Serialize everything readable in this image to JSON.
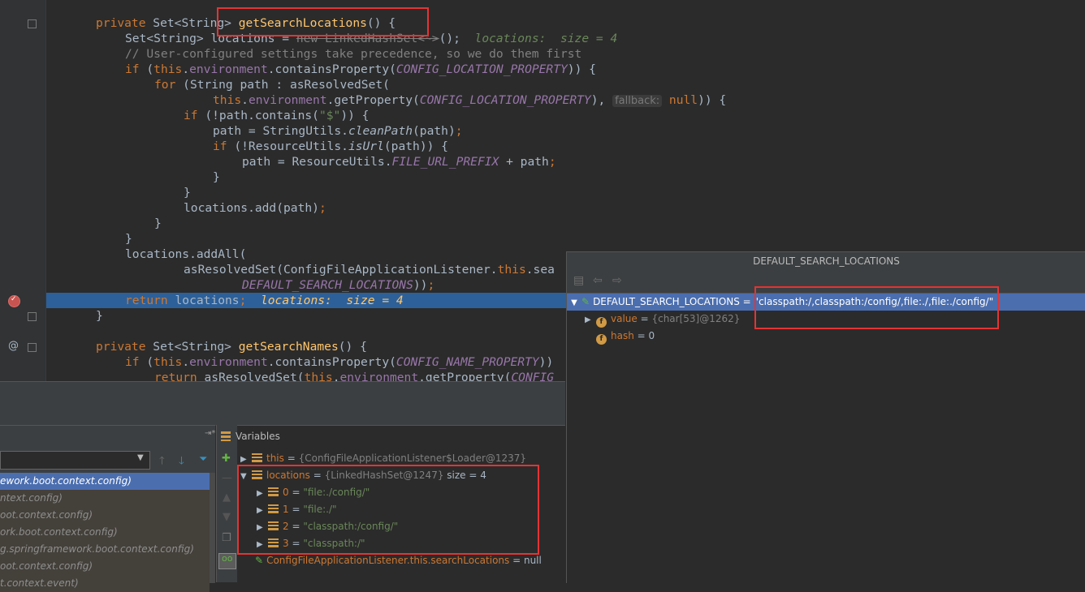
{
  "editor": {
    "lines": [
      {
        "indent": 0,
        "tokens": [
          {
            "t": "private ",
            "c": "kw"
          },
          {
            "t": "Set<String> ",
            "c": ""
          },
          {
            "t": "getSearchLocations",
            "c": "fn"
          },
          {
            "t": "() {",
            "c": ""
          }
        ]
      },
      {
        "indent": 1,
        "tokens": [
          {
            "t": "Set<String> ",
            "c": ""
          },
          {
            "t": "locations = ",
            "c": ""
          },
          {
            "t": "new LinkedHashSet<~>",
            "c": "strike"
          },
          {
            "t": "();",
            "c": ""
          },
          {
            "t": "  locations:  size = 4",
            "c": "inl"
          }
        ]
      },
      {
        "indent": 1,
        "tokens": [
          {
            "t": "// User-configured settings take precedence, so we do them first",
            "c": "cm"
          }
        ]
      },
      {
        "indent": 1,
        "tokens": [
          {
            "t": "if ",
            "c": "kw"
          },
          {
            "t": "(",
            "c": ""
          },
          {
            "t": "this",
            "c": "kw"
          },
          {
            "t": ".",
            "c": ""
          },
          {
            "t": "environment",
            "c": "fld"
          },
          {
            "t": ".containsProperty(",
            "c": ""
          },
          {
            "t": "CONFIG_LOCATION_PROPERTY",
            "c": "fldi"
          },
          {
            "t": ")) {",
            "c": ""
          }
        ]
      },
      {
        "indent": 2,
        "tokens": [
          {
            "t": "for ",
            "c": "kw"
          },
          {
            "t": "(String path : asResolvedSet(",
            "c": ""
          }
        ]
      },
      {
        "indent": 4,
        "tokens": [
          {
            "t": "this",
            "c": "kw"
          },
          {
            "t": ".",
            "c": ""
          },
          {
            "t": "environment",
            "c": "fld"
          },
          {
            "t": ".getProperty(",
            "c": ""
          },
          {
            "t": "CONFIG_LOCATION_PROPERTY",
            "c": "fldi"
          },
          {
            "t": "), ",
            "c": ""
          },
          {
            "t": "fallback:",
            "c": "hint"
          },
          {
            "t": " null",
            "c": "kw"
          },
          {
            "t": ")) {",
            "c": ""
          }
        ]
      },
      {
        "indent": 3,
        "tokens": [
          {
            "t": "if ",
            "c": "kw"
          },
          {
            "t": "(!path.contains(",
            "c": ""
          },
          {
            "t": "\"$\"",
            "c": "str"
          },
          {
            "t": ")) {",
            "c": ""
          }
        ]
      },
      {
        "indent": 4,
        "tokens": [
          {
            "t": "path = StringUtils.",
            "c": ""
          },
          {
            "t": "cleanPath",
            "c": "sti"
          },
          {
            "t": "(path)",
            "c": ""
          },
          {
            "t": ";",
            "c": "kw"
          }
        ]
      },
      {
        "indent": 4,
        "tokens": [
          {
            "t": "if ",
            "c": "kw"
          },
          {
            "t": "(!ResourceUtils.",
            "c": ""
          },
          {
            "t": "isUrl",
            "c": "sti"
          },
          {
            "t": "(path)) {",
            "c": ""
          }
        ]
      },
      {
        "indent": 5,
        "tokens": [
          {
            "t": "path = ResourceUtils.",
            "c": ""
          },
          {
            "t": "FILE_URL_PREFIX",
            "c": "fldi"
          },
          {
            "t": " + path",
            "c": ""
          },
          {
            "t": ";",
            "c": "kw"
          }
        ]
      },
      {
        "indent": 4,
        "tokens": [
          {
            "t": "}",
            "c": ""
          }
        ]
      },
      {
        "indent": 3,
        "tokens": [
          {
            "t": "}",
            "c": ""
          }
        ]
      },
      {
        "indent": 3,
        "tokens": [
          {
            "t": "locations.add(path)",
            "c": ""
          },
          {
            "t": ";",
            "c": "kw"
          }
        ]
      },
      {
        "indent": 2,
        "tokens": [
          {
            "t": "}",
            "c": ""
          }
        ]
      },
      {
        "indent": 1,
        "tokens": [
          {
            "t": "}",
            "c": ""
          }
        ]
      },
      {
        "indent": 1,
        "tokens": [
          {
            "t": "locations.addAll(",
            "c": ""
          }
        ]
      },
      {
        "indent": 3,
        "tokens": [
          {
            "t": "asResolvedSet(ConfigFileApplicationListener.",
            "c": ""
          },
          {
            "t": "this",
            "c": "kw"
          },
          {
            "t": ".sea",
            "c": ""
          }
        ]
      },
      {
        "indent": 5,
        "tokens": [
          {
            "t": "DEFAULT_SEARCH_LOCATIONS",
            "c": "fldi"
          },
          {
            "t": "))",
            "c": ""
          },
          {
            "t": ";",
            "c": "kw"
          }
        ]
      },
      {
        "indent": 1,
        "tokens": [
          {
            "t": "return ",
            "c": "kw"
          },
          {
            "t": "locations",
            "c": ""
          },
          {
            "t": ";",
            "c": "kw"
          },
          {
            "t": "  locations:  size = 4",
            "c": "inlw"
          }
        ]
      },
      {
        "indent": 0,
        "tokens": [
          {
            "t": "}",
            "c": ""
          }
        ]
      },
      {
        "indent": 0,
        "tokens": []
      },
      {
        "indent": 0,
        "tokens": [
          {
            "t": "private ",
            "c": "kw"
          },
          {
            "t": "Set<String> ",
            "c": ""
          },
          {
            "t": "getSearchNames",
            "c": "fn"
          },
          {
            "t": "() {",
            "c": ""
          }
        ]
      },
      {
        "indent": 1,
        "tokens": [
          {
            "t": "if ",
            "c": "kw"
          },
          {
            "t": "(",
            "c": ""
          },
          {
            "t": "this",
            "c": "kw"
          },
          {
            "t": ".",
            "c": ""
          },
          {
            "t": "environment",
            "c": "fld"
          },
          {
            "t": ".containsProperty(",
            "c": ""
          },
          {
            "t": "CONFIG_NAME_PROPERTY",
            "c": "fldi"
          },
          {
            "t": "))",
            "c": ""
          }
        ]
      },
      {
        "indent": 2,
        "tokens": [
          {
            "t": "return ",
            "c": "kw"
          },
          {
            "t": "asResolvedSet(",
            "c": ""
          },
          {
            "t": "this",
            "c": "kw"
          },
          {
            "t": ".",
            "c": ""
          },
          {
            "t": "environment",
            "c": "fld"
          },
          {
            "t": ".getProperty(",
            "c": ""
          },
          {
            "t": "CONFIG",
            "c": "fldi"
          }
        ]
      }
    ],
    "gutter_marker_at": "@"
  },
  "frames": {
    "items": [
      "ework.boot.context.config)",
      "ntext.config)",
      "oot.context.config)",
      "ork.boot.context.config)",
      "g.springframework.boot.context.config)",
      "oot.context.config)",
      "t.context.event)"
    ]
  },
  "variables": {
    "header": "Variables",
    "this_name": "this",
    "this_value": "{ConfigFileApplicationListener$Loader@1237}",
    "locations_name": "locations",
    "locations_value": "{LinkedHashSet@1247}",
    "locations_size": "size = 4",
    "children": [
      {
        "index": "0",
        "value": "\"file:./config/\""
      },
      {
        "index": "1",
        "value": "\"file:./\""
      },
      {
        "index": "2",
        "value": "\"classpath:/config/\""
      },
      {
        "index": "3",
        "value": "\"classpath:/\""
      }
    ],
    "watch_name": "ConfigFileApplicationListener.this.searchLocations",
    "watch_value": "= null"
  },
  "popup": {
    "title": "DEFAULT_SEARCH_LOCATIONS",
    "root_name": "DEFAULT_SEARCH_LOCATIONS",
    "root_eq": " = ",
    "root_value": "\"classpath:/,classpath:/config/,file:./,file:./config/\"",
    "value_name": "value",
    "value_value": "{char[53]@1262}",
    "hash_name": "hash",
    "hash_value": "0"
  }
}
